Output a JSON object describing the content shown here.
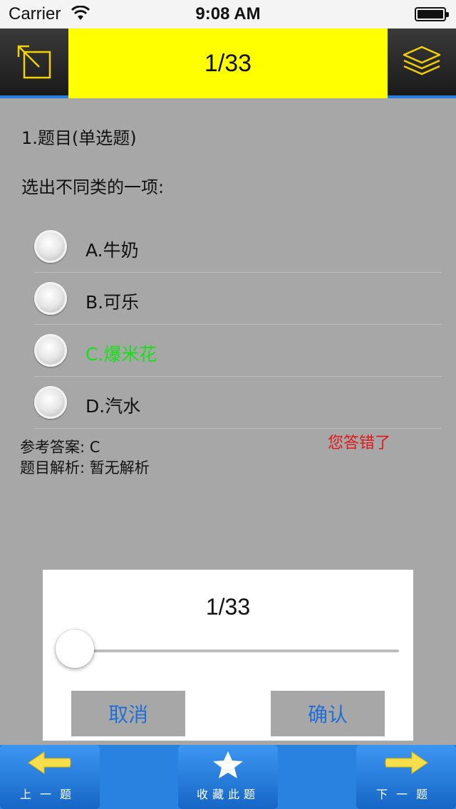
{
  "status": {
    "carrier": "Carrier",
    "time": "9:08 AM"
  },
  "nav": {
    "title": "1/33",
    "left_icon": "expand-arrow-icon",
    "right_icon": "layers-icon"
  },
  "question": {
    "heading": "1.题目(单选题)",
    "text": "选出不同类的一项:",
    "options": [
      {
        "label": "A.牛奶",
        "state": "normal"
      },
      {
        "label": "B.可乐",
        "state": "normal"
      },
      {
        "label": "C.爆米花",
        "state": "correct"
      },
      {
        "label": "D.汽水",
        "state": "normal"
      }
    ],
    "answer_line": "参考答案: C",
    "analysis_line": "题目解析: 暂无解析",
    "result": "您答错了"
  },
  "dialog": {
    "count": "1/33",
    "slider_value": 1,
    "slider_max": 33,
    "cancel_label": "取消",
    "confirm_label": "确认"
  },
  "toolbar": {
    "prev_label": "上一题",
    "favorite_label": "收藏此题",
    "next_label": "下一题"
  },
  "colors": {
    "nav_title_bg": "#ffff00",
    "accent_blue": "#2a82e0",
    "correct_green": "#16e016",
    "wrong_red": "#e01818",
    "icon_yellow": "#f5d000"
  }
}
